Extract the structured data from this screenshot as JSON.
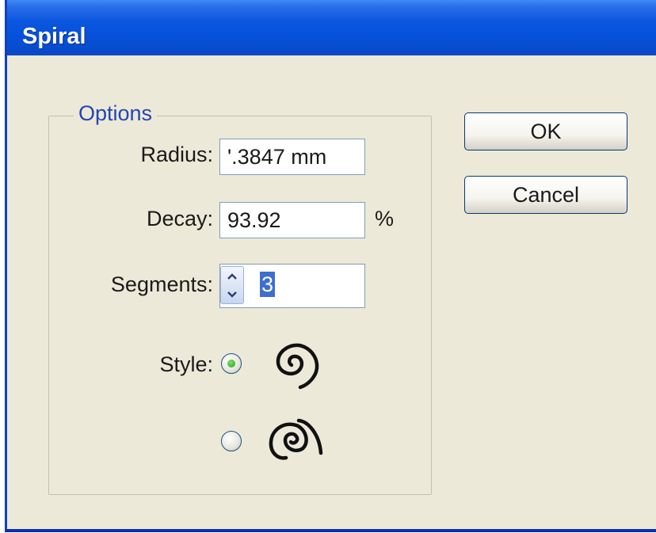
{
  "window": {
    "title": "Spiral"
  },
  "options": {
    "group_label": "Options",
    "radius": {
      "label": "Radius:",
      "value": "'.3847 mm"
    },
    "decay": {
      "label": "Decay:",
      "value": "93.92",
      "unit": "%"
    },
    "segments": {
      "label": "Segments:",
      "value": "3"
    },
    "style": {
      "label": "Style:",
      "choices": [
        {
          "icon": "spiral-clockwise-icon",
          "selected": true
        },
        {
          "icon": "spiral-counterclockwise-icon",
          "selected": false
        }
      ]
    }
  },
  "buttons": {
    "ok": "OK",
    "cancel": "Cancel"
  },
  "colors": {
    "titlebar": "#0550d8",
    "dialog_bg": "#ece9d8",
    "group_label": "#2446b3",
    "selection": "#3d6fd1",
    "radio_dot": "#21a11a"
  }
}
